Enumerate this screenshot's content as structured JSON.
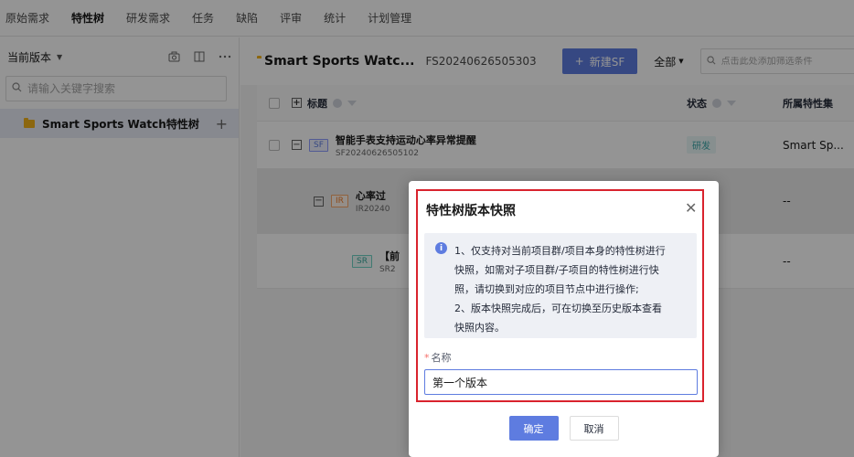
{
  "topnav": {
    "tabs": [
      "原始需求",
      "特性树",
      "研发需求",
      "任务",
      "缺陷",
      "评审",
      "统计",
      "计划管理"
    ],
    "active_index": 1
  },
  "left": {
    "version_select": "当前版本",
    "search": {
      "placeholder": "请输入关键字搜索"
    },
    "tree": {
      "root_label": "Smart Sports Watch特性树"
    }
  },
  "right": {
    "project_title": "Smart Sports Watc...",
    "project_code": "FS20240626505303",
    "new_sf_label": "新建SF",
    "scope_select": "全部",
    "filter": {
      "placeholder": "点击此处添加筛选条件"
    },
    "columns": {
      "title": "标题",
      "status": "状态",
      "feature_set": "所属特性集"
    },
    "rows": [
      {
        "tag": "SF",
        "name": "智能手表支持运动心率异常提醒",
        "code": "SF20240626505102",
        "status": "研发",
        "feature_set": "Smart Sp..."
      },
      {
        "tag": "IR",
        "name": "心率过",
        "code": "IR20240",
        "status": "",
        "feature_set": "--"
      },
      {
        "tag": "SR",
        "name": "【前",
        "code": "SR2",
        "status": "",
        "feature_set": "--"
      }
    ]
  },
  "modal": {
    "title": "特性树版本快照",
    "notice": {
      "line1": "1、仅支持对当前项目群/项目本身的特性树进行",
      "line2": "快照，如需对子项目群/子项目的特性树进行快",
      "line3": "照，请切换到对应的项目节点中进行操作;",
      "line4": "2、版本快照完成后，可在切换至历史版本查看",
      "line5": "快照内容。"
    },
    "name_label": "名称",
    "name_value": "第一个版本",
    "ok_label": "确定",
    "cancel_label": "取消"
  },
  "colors": {
    "primary": "#5e7ce0",
    "highlight_border": "#d9232d",
    "folder": "#f2b21b"
  },
  "icons": [
    "camera-icon",
    "columns-icon",
    "more-icon",
    "search-icon",
    "folder-icon",
    "plus-icon",
    "filter-search-icon",
    "help-icon",
    "funnel-icon",
    "info-icon",
    "close-icon"
  ]
}
